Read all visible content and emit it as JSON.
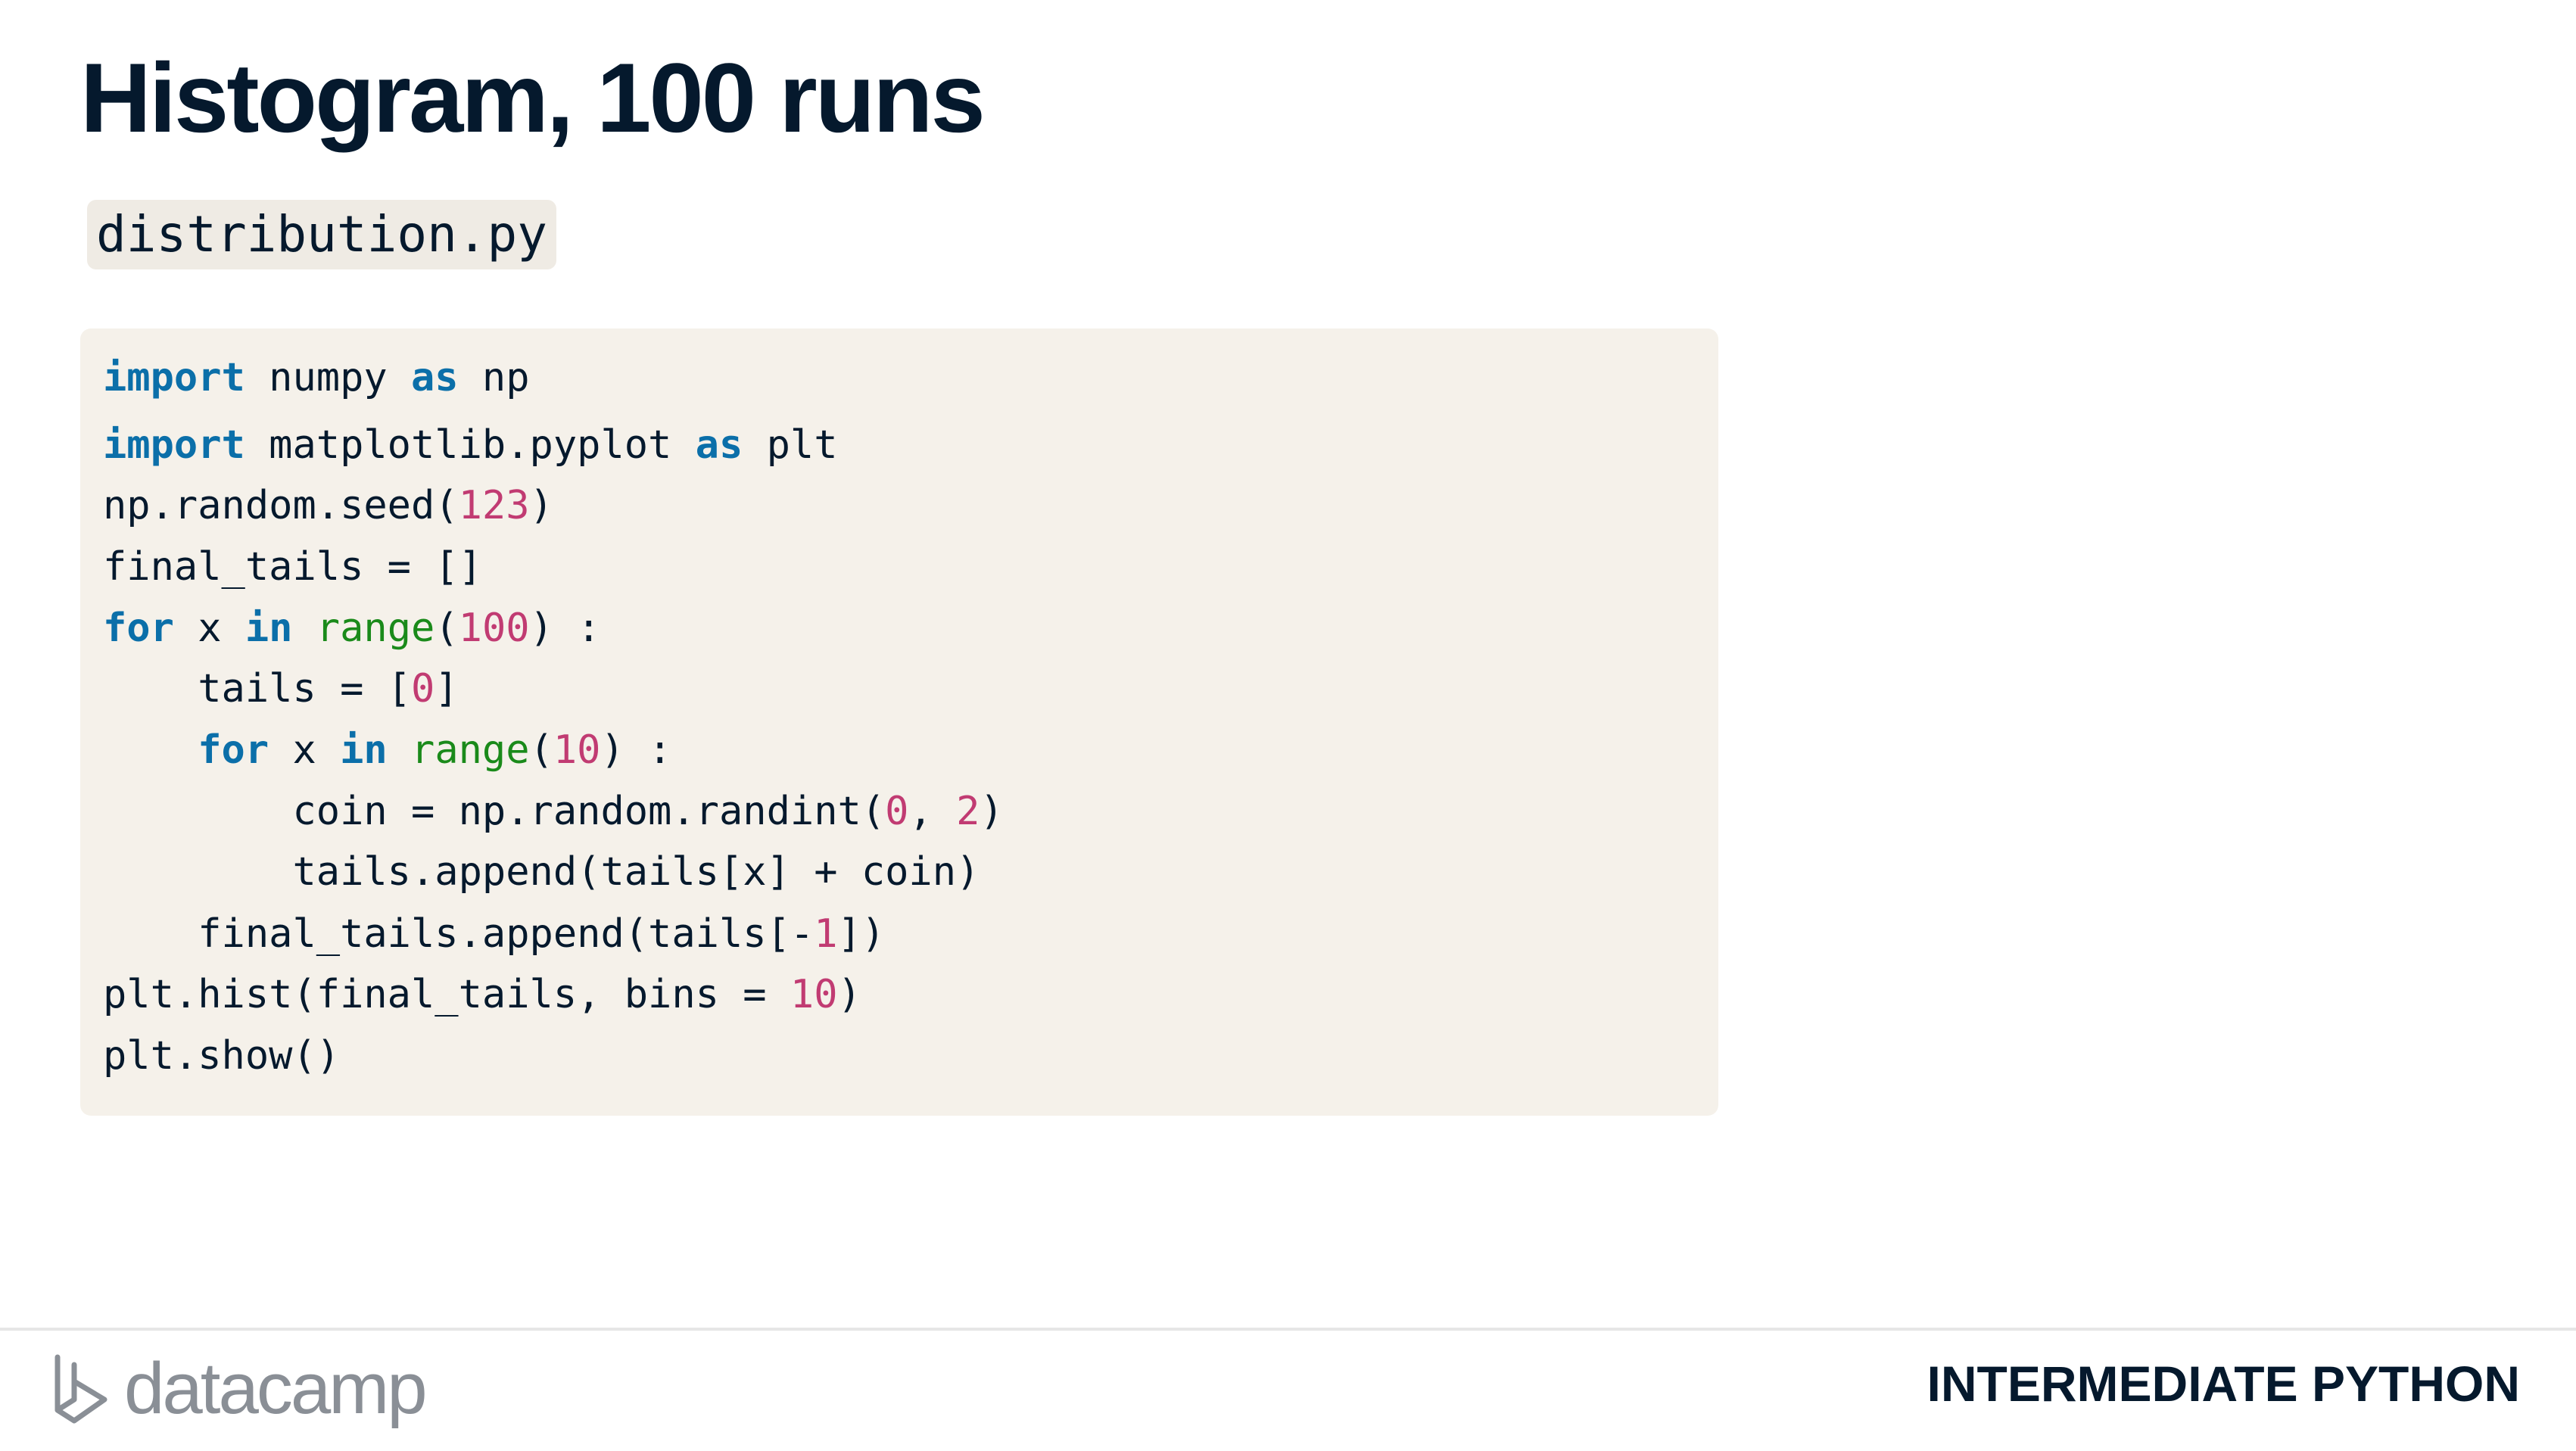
{
  "slide": {
    "title": "Histogram, 100 runs",
    "filename": "distribution.py"
  },
  "code": {
    "language": "python",
    "lines": [
      [
        {
          "t": "import",
          "c": "kw"
        },
        {
          "t": " numpy "
        },
        {
          "t": "as",
          "c": "kw"
        },
        {
          "t": " np"
        }
      ],
      [
        {
          "t": "import",
          "c": "kw"
        },
        {
          "t": " matplotlib.pyplot "
        },
        {
          "t": "as",
          "c": "kw"
        },
        {
          "t": " plt"
        }
      ],
      [
        {
          "t": "np.random.seed("
        },
        {
          "t": "123",
          "c": "num"
        },
        {
          "t": ")"
        }
      ],
      [
        {
          "t": "final_tails = []"
        }
      ],
      [
        {
          "t": "for",
          "c": "kw"
        },
        {
          "t": " x "
        },
        {
          "t": "in",
          "c": "kw"
        },
        {
          "t": " "
        },
        {
          "t": "range",
          "c": "bi"
        },
        {
          "t": "("
        },
        {
          "t": "100",
          "c": "num"
        },
        {
          "t": ") :"
        }
      ],
      [
        {
          "t": "    tails = ["
        },
        {
          "t": "0",
          "c": "num"
        },
        {
          "t": "]"
        }
      ],
      [
        {
          "t": "    "
        },
        {
          "t": "for",
          "c": "kw"
        },
        {
          "t": " x "
        },
        {
          "t": "in",
          "c": "kw"
        },
        {
          "t": " "
        },
        {
          "t": "range",
          "c": "bi"
        },
        {
          "t": "("
        },
        {
          "t": "10",
          "c": "num"
        },
        {
          "t": ") :"
        }
      ],
      [
        {
          "t": "        coin = np.random.randint("
        },
        {
          "t": "0",
          "c": "num"
        },
        {
          "t": ", "
        },
        {
          "t": "2",
          "c": "num"
        },
        {
          "t": ")"
        }
      ],
      [
        {
          "t": "        tails.append(tails[x] + coin)"
        }
      ],
      [
        {
          "t": "    final_tails.append(tails[-"
        },
        {
          "t": "1",
          "c": "num"
        },
        {
          "t": "])"
        }
      ],
      [
        {
          "t": "plt.hist(final_tails, bins = "
        },
        {
          "t": "10",
          "c": "num"
        },
        {
          "t": ")"
        }
      ],
      [
        {
          "t": "plt.show()"
        }
      ]
    ]
  },
  "footer": {
    "brand": "datacamp",
    "logo_icon": "datacamp-logo-icon",
    "course": "INTERMEDIATE PYTHON"
  },
  "colors": {
    "title": "#05192d",
    "keyword": "#0b6fa9",
    "builtin": "#1a8a1a",
    "number": "#c13b72",
    "code_background": "#f5f1ea",
    "filename_background": "#efebe4"
  }
}
